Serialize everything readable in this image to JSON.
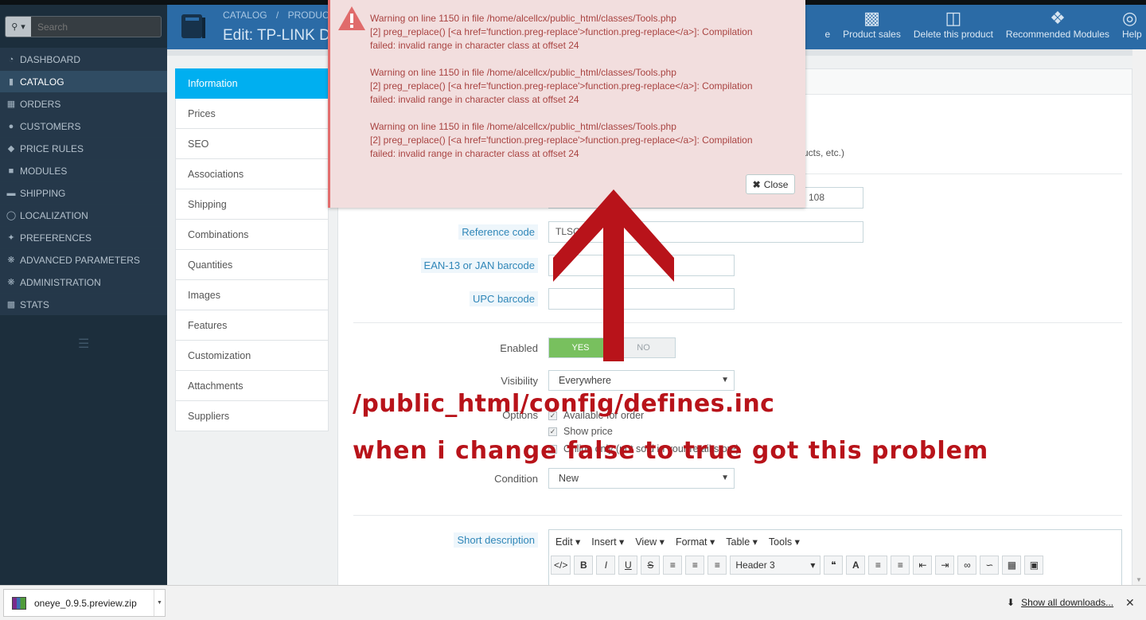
{
  "colors": {
    "sidebar_bg": "#1c2e3c",
    "header_bg": "#2b6ba6",
    "active_tab": "#00aff0",
    "alert_bg": "#f2dede",
    "alert_text": "#a94442",
    "annotation": "#b8131a"
  },
  "search": {
    "placeholder": "Search"
  },
  "sidebar": {
    "items": [
      {
        "label": "DASHBOARD",
        "icon": "dashboard-icon"
      },
      {
        "label": "CATALOG",
        "icon": "book-icon"
      },
      {
        "label": "ORDERS",
        "icon": "card-icon"
      },
      {
        "label": "CUSTOMERS",
        "icon": "users-icon"
      },
      {
        "label": "PRICE RULES",
        "icon": "tag-icon"
      },
      {
        "label": "MODULES",
        "icon": "puzzle-icon"
      },
      {
        "label": "SHIPPING",
        "icon": "truck-icon"
      },
      {
        "label": "LOCALIZATION",
        "icon": "globe-icon"
      },
      {
        "label": "PREFERENCES",
        "icon": "wrench-icon"
      },
      {
        "label": "ADVANCED PARAMETERS",
        "icon": "cogs-icon"
      },
      {
        "label": "ADMINISTRATION",
        "icon": "cog-icon"
      },
      {
        "label": "STATS",
        "icon": "bar-chart-icon"
      }
    ]
  },
  "header": {
    "breadcrumb_1": "CATALOG",
    "breadcrumb_sep": "/",
    "breadcrumb_2": "PRODUCT",
    "title": "Edit: TP-LINK D",
    "toolbar": {
      "cut_label": "e",
      "product_sales": "Product sales",
      "delete_product": "Delete this product",
      "recommended_modules": "Recommended Modules",
      "help": "Help"
    }
  },
  "tabs": [
    "Information",
    "Prices",
    "SEO",
    "Associations",
    "Shipping",
    "Combinations",
    "Quantities",
    "Images",
    "Features",
    "Customization",
    "Attachments",
    "Suppliers"
  ],
  "form": {
    "visible_desc_fragment": "ucts, etc.)",
    "field_fragment": "108",
    "reference_label": "Reference code",
    "reference_value": "TLSG",
    "ean_label": "EAN-13 or JAN barcode",
    "upc_label": "UPC barcode",
    "enabled_label": "Enabled",
    "yes": "YES",
    "no": "NO",
    "visibility_label": "Visibility",
    "visibility_value": "Everywhere",
    "options_label": "Options",
    "opt_available": "Available for order",
    "opt_show_price": "Show price",
    "opt_online_only": "Online only (not sold in your retail store)",
    "condition_label": "Condition",
    "condition_value": "New",
    "short_desc_label": "Short description"
  },
  "editor": {
    "menus": [
      "Edit",
      "Insert",
      "View",
      "Format",
      "Table",
      "Tools"
    ],
    "format_value": "Header 3"
  },
  "alert": {
    "messages": [
      {
        "line1": "Warning on line 1150 in file /home/alcellcx/public_html/classes/Tools.php",
        "line2": "[2] preg_replace() [<a href='function.preg-replace'>function.preg-replace</a>]: Compilation",
        "line3": "failed: invalid range in character class at offset 24"
      },
      {
        "line1": "Warning on line 1150 in file /home/alcellcx/public_html/classes/Tools.php",
        "line2": "[2] preg_replace() [<a href='function.preg-replace'>function.preg-replace</a>]: Compilation",
        "line3": "failed: invalid range in character class at offset 24"
      },
      {
        "line1": "Warning on line 1150 in file /home/alcellcx/public_html/classes/Tools.php",
        "line2": "[2] preg_replace() [<a href='function.preg-replace'>function.preg-replace</a>]: Compilation",
        "line3": "failed: invalid range in character class at offset 24"
      }
    ],
    "close_label": "Close"
  },
  "annotation": {
    "line1": "/public_html/config/defines.inc",
    "line2": "when i change false to true got this problem"
  },
  "downloads": {
    "filename": "oneye_0.9.5.preview.zip",
    "show_all": "Show all downloads..."
  }
}
